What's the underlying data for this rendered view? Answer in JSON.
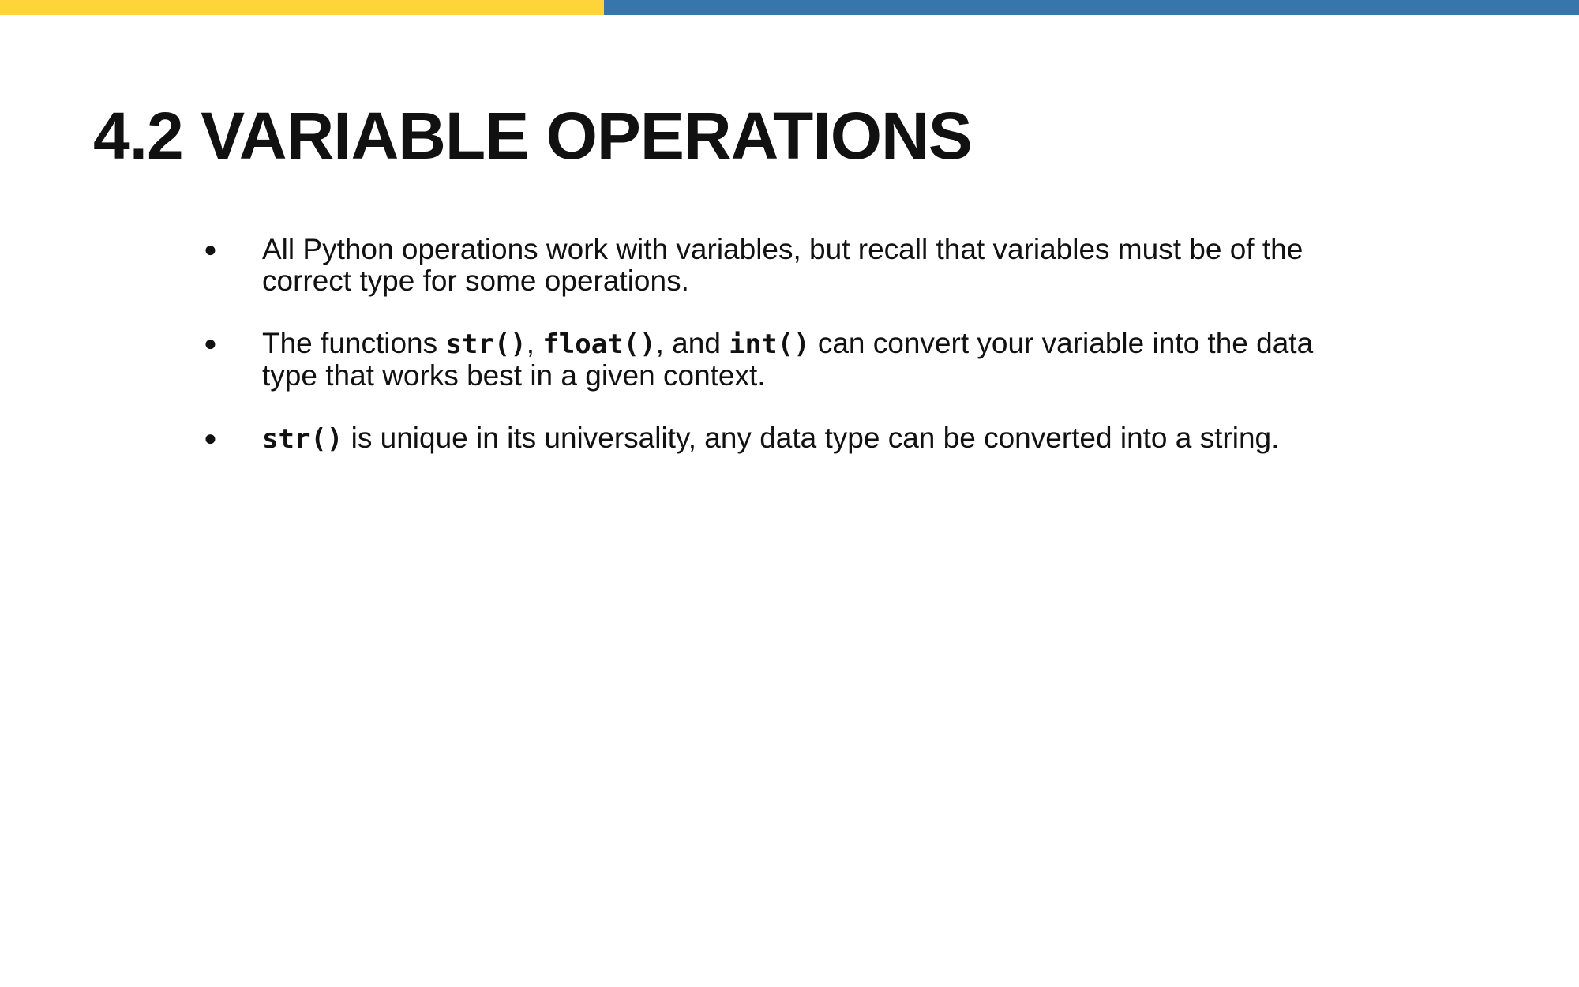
{
  "colors": {
    "accent_yellow": "#FFD43B",
    "accent_blue": "#3776AB",
    "text": "#111111",
    "background": "#FFFFFF"
  },
  "slide": {
    "title": "4.2 VARIABLE OPERATIONS",
    "bullets": [
      {
        "marker": "●",
        "text": "All Python operations work with variables, but recall that variables must be of the correct type for some operations."
      },
      {
        "marker": "●",
        "t1": "The functions ",
        "c1": "str()",
        "t2": ", ",
        "c2": "float()",
        "t3": ", and ",
        "c3": "int()",
        "t4": " can convert your variable into the data type that works best in a given context."
      },
      {
        "marker": "●",
        "c1": "str()",
        "t1": " is unique in its universality, any data type can be converted into a string."
      }
    ]
  }
}
